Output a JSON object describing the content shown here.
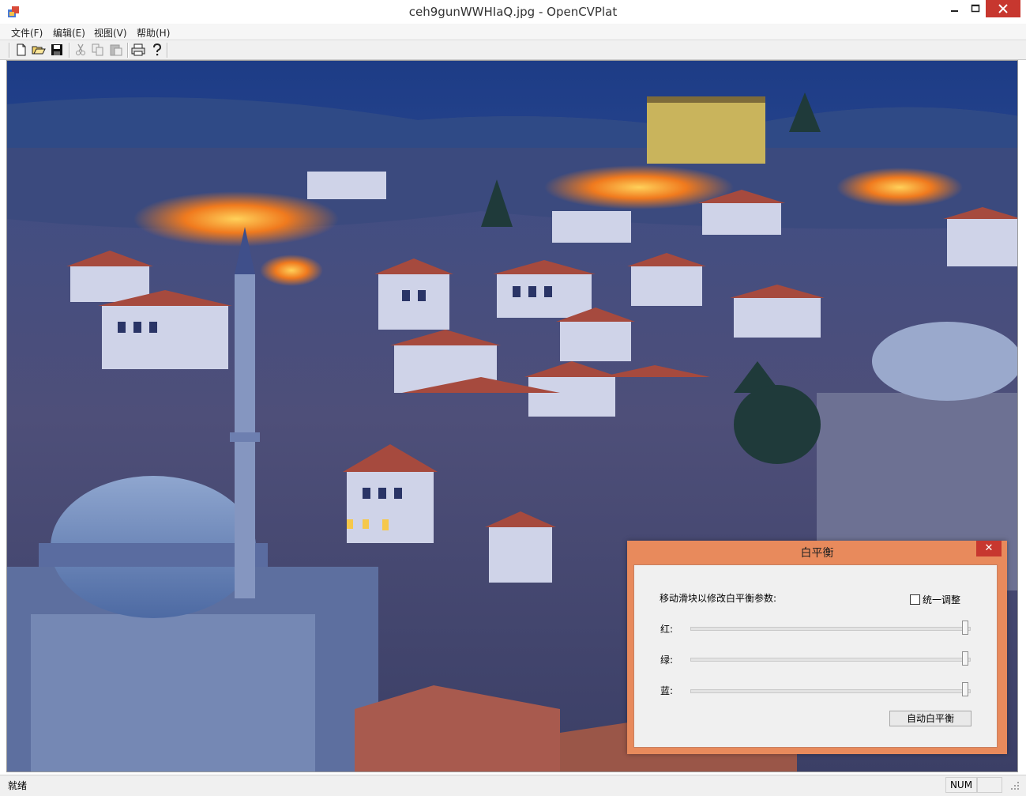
{
  "window": {
    "title": "ceh9gunWWHIaQ.jpg - OpenCVPlat"
  },
  "menu": {
    "items": [
      "文件(F)",
      "编辑(E)",
      "视图(V)",
      "帮助(H)"
    ]
  },
  "toolbar": {
    "icons": [
      "new-file-icon",
      "open-folder-icon",
      "save-icon",
      "cut-icon",
      "copy-icon",
      "paste-icon",
      "print-icon",
      "help-icon"
    ]
  },
  "image": {
    "description_icon": "city-night-photo"
  },
  "status": {
    "text": "就绪",
    "num": "NUM"
  },
  "dialog": {
    "title": "白平衡",
    "close": "✕",
    "instruction": "移动滑块以修改白平衡参数:",
    "unify_label": "统一调整",
    "unify_checked": false,
    "sliders": [
      {
        "label": "红:",
        "value": 1.0
      },
      {
        "label": "绿:",
        "value": 1.0
      },
      {
        "label": "蓝:",
        "value": 1.0
      }
    ],
    "auto_button": "自动白平衡"
  },
  "colors": {
    "dialog_frame": "#e88a5c",
    "close_button": "#c7372f"
  }
}
